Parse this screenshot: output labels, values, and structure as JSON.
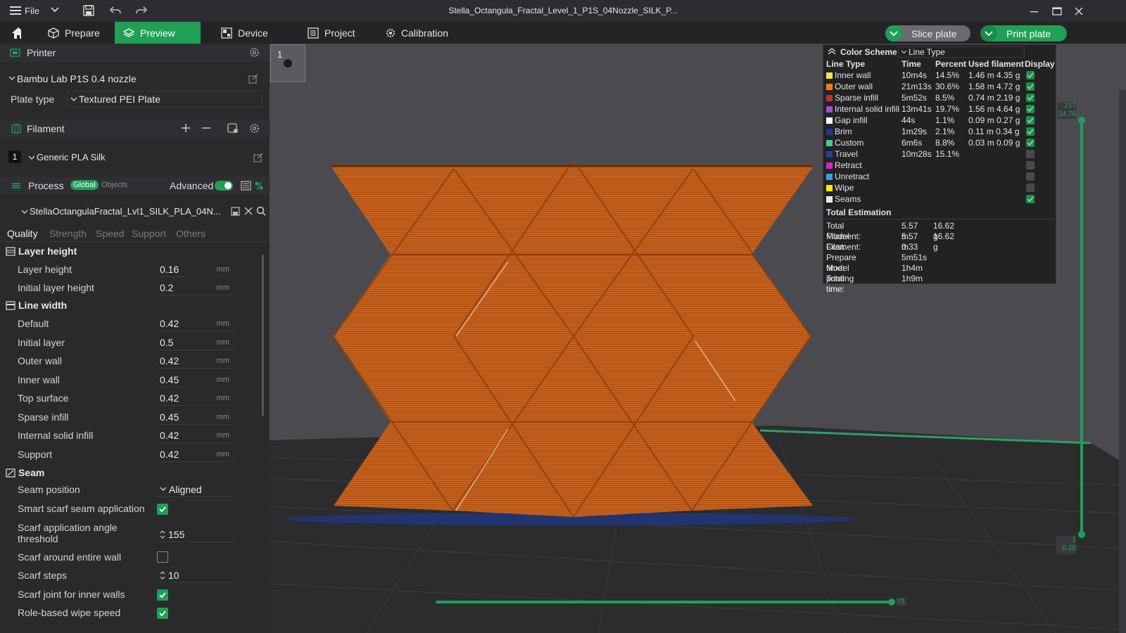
{
  "window": {
    "menu_label": "File",
    "title": "Stella_Octangula_Fractal_Level_1_P1S_04Nozzle_SILK_P..."
  },
  "tabs": [
    {
      "label": "Prepare"
    },
    {
      "label": "Preview"
    },
    {
      "label": "Device"
    },
    {
      "label": "Project"
    },
    {
      "label": "Calibration"
    }
  ],
  "actions": {
    "slice": "Slice plate",
    "print": "Print plate"
  },
  "printer": {
    "section": "Printer",
    "name": "Bambu Lab P1S 0.4 nozzle",
    "plate_type_label": "Plate type",
    "plate_type_value": "Textured PEI Plate"
  },
  "filament": {
    "section": "Filament",
    "slot": "1",
    "name": "Generic PLA Silk"
  },
  "process": {
    "section": "Process",
    "global": "Global",
    "objects": "Objects",
    "advanced": "Advanced",
    "advanced_on": true,
    "profile": "StellaOctangulaFractal_Lvl1_SILK_PLA_04N...",
    "subtabs": [
      "Quality",
      "Strength",
      "Speed",
      "Support",
      "Others"
    ]
  },
  "settings": {
    "layer_height_group": "Layer height",
    "layer_height": {
      "label": "Layer height",
      "value": "0.16",
      "unit": "mm"
    },
    "initial_layer_height": {
      "label": "Initial layer height",
      "value": "0.2",
      "unit": "mm"
    },
    "line_width_group": "Line width",
    "lw_default": {
      "label": "Default",
      "value": "0.42",
      "unit": "mm"
    },
    "lw_initial": {
      "label": "Initial layer",
      "value": "0.5",
      "unit": "mm"
    },
    "lw_outer": {
      "label": "Outer wall",
      "value": "0.42",
      "unit": "mm"
    },
    "lw_inner": {
      "label": "Inner wall",
      "value": "0.45",
      "unit": "mm"
    },
    "lw_top": {
      "label": "Top surface",
      "value": "0.42",
      "unit": "mm"
    },
    "lw_sparse": {
      "label": "Sparse infill",
      "value": "0.45",
      "unit": "mm"
    },
    "lw_internal": {
      "label": "Internal solid infill",
      "value": "0.42",
      "unit": "mm"
    },
    "lw_support": {
      "label": "Support",
      "value": "0.42",
      "unit": "mm"
    },
    "seam_group": "Seam",
    "seam_position": {
      "label": "Seam position",
      "value": "Aligned"
    },
    "smart_scarf": {
      "label": "Smart scarf seam application",
      "checked": true
    },
    "scarf_angle": {
      "label1": "Scarf application angle",
      "label2": "threshold",
      "value": "155"
    },
    "scarf_entire": {
      "label": "Scarf around entire wall",
      "checked": false
    },
    "scarf_steps": {
      "label": "Scarf steps",
      "value": "10"
    },
    "scarf_inner": {
      "label": "Scarf joint for inner walls",
      "checked": true
    },
    "role_wipe": {
      "label": "Role-based wipe speed",
      "checked": true
    }
  },
  "plate_thumb": {
    "number": "1"
  },
  "legend": {
    "color_scheme_label": "Color Scheme",
    "color_scheme_value": "Line Type",
    "headers": {
      "type": "Line Type",
      "time": "Time",
      "percent": "Percent",
      "used": "Used filament",
      "display": "Display"
    },
    "rows": [
      {
        "name": "Inner wall",
        "color": "#ffe14d",
        "time": "10m4s",
        "percent": "14.5%",
        "used": "1.46 m  4.35 g",
        "display": true
      },
      {
        "name": "Outer wall",
        "color": "#ff7a1a",
        "time": "21m13s",
        "percent": "30.6%",
        "used": "1.58 m  4.72 g",
        "display": true
      },
      {
        "name": "Sparse infill",
        "color": "#b83232",
        "time": "5m52s",
        "percent": "8.5%",
        "used": "0.74 m  2.19 g",
        "display": true
      },
      {
        "name": "Internal solid infill",
        "color": "#a050c8",
        "time": "13m41s",
        "percent": "19.7%",
        "used": "1.56 m  4.64 g",
        "display": true
      },
      {
        "name": "Gap infill",
        "color": "#ffffff",
        "time": "44s",
        "percent": "1.1%",
        "used": "0.09 m  0.27 g",
        "display": true
      },
      {
        "name": "Brim",
        "color": "#1f3a8a",
        "time": "1m29s",
        "percent": "2.1%",
        "used": "0.11 m  0.34 g",
        "display": true
      },
      {
        "name": "Custom",
        "color": "#3fcf8e",
        "time": "6m6s",
        "percent": "8.8%",
        "used": "0.03 m  0.09 g",
        "display": true
      },
      {
        "name": "Travel",
        "color": "#2c3e8f",
        "time": "10m28s",
        "percent": "15.1%",
        "used": "",
        "display": false
      },
      {
        "name": "Retract",
        "color": "#e020d0",
        "time": "",
        "percent": "",
        "used": "",
        "display": false
      },
      {
        "name": "Unretract",
        "color": "#3aa0d0",
        "time": "",
        "percent": "",
        "used": "",
        "display": false
      },
      {
        "name": "Wipe",
        "color": "#ffee00",
        "time": "",
        "percent": "",
        "used": "",
        "display": false
      },
      {
        "name": "Seams",
        "color": "#e8e8e8",
        "time": "",
        "percent": "",
        "used": "",
        "display": true
      }
    ],
    "total_title": "Total Estimation",
    "totals": [
      {
        "k": "Total Filament:",
        "v1": "5.57 m",
        "v2": "16.62 g"
      },
      {
        "k": "Model Filament:",
        "v1": "5.57 m",
        "v2": "16.62 g"
      },
      {
        "k": "Cost:",
        "v1": "0.33",
        "v2": ""
      },
      {
        "k": "Prepare time:",
        "v1": "5m51s",
        "v2": ""
      },
      {
        "k": "Model printing time:",
        "v1": "1h4m",
        "v2": ""
      },
      {
        "k": "Total time:",
        "v1": "1h9m",
        "v2": ""
      }
    ]
  },
  "sliders": {
    "layer_top_num": "217",
    "layer_top_height": "34.76",
    "layer_bottom_num": "1",
    "layer_bottom_height": "0.20",
    "move_value": "71"
  },
  "colors": {
    "accent": "#1fa054",
    "model": "#c8621e",
    "panel": "#2a2a2d"
  }
}
